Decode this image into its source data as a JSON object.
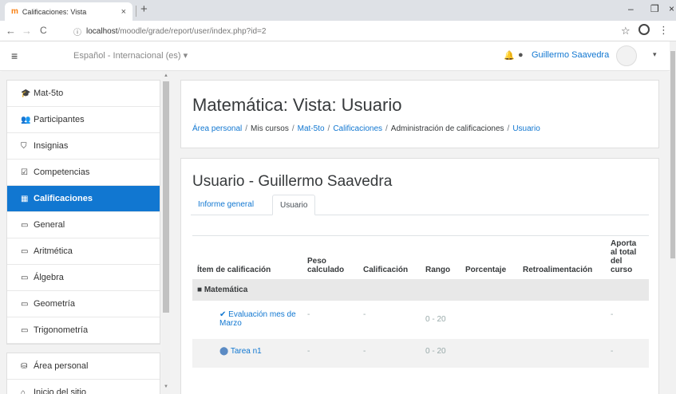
{
  "browser": {
    "tab_title": "Calificaciones: Vista",
    "tab_close": "×",
    "new_tab": "+",
    "win_min": "–",
    "win_max": "❐",
    "win_close": "×",
    "back": "←",
    "forward": "→",
    "reload": "C",
    "url_host": "localhost",
    "url_path": "/moodle/grade/report/user/index.php?id=2",
    "star": "☆",
    "menu": "⋮"
  },
  "navbar": {
    "menu_icon": "≡",
    "language": "Español - Internacional (es) ▾",
    "bell": "🔔",
    "chat": "●",
    "user_name": "Guillermo Saavedra",
    "user_caret": "▾"
  },
  "drawer": {
    "course_items": [
      {
        "icon": "🎓",
        "label": "Mat-5to"
      },
      {
        "icon": "👥",
        "label": "Participantes"
      },
      {
        "icon": "⛉",
        "label": "Insignias"
      },
      {
        "icon": "☑",
        "label": "Competencias"
      },
      {
        "icon": "▦",
        "label": "Calificaciones"
      },
      {
        "icon": "▭",
        "label": "General"
      },
      {
        "icon": "▭",
        "label": "Aritmética"
      },
      {
        "icon": "▭",
        "label": "Álgebra"
      },
      {
        "icon": "▭",
        "label": "Geometría"
      },
      {
        "icon": "▭",
        "label": "Trigonometría"
      }
    ],
    "site_items": [
      {
        "icon": "⛁",
        "label": "Área personal"
      },
      {
        "icon": "⌂",
        "label": "Inicio del sitio"
      }
    ]
  },
  "page": {
    "title": "Matemática: Vista: Usuario",
    "breadcrumb": [
      {
        "label": "Área personal",
        "link": true
      },
      {
        "label": "Mis cursos",
        "link": false
      },
      {
        "label": "Mat-5to",
        "link": true
      },
      {
        "label": "Calificaciones",
        "link": true
      },
      {
        "label": "Administración de calificaciones",
        "link": false
      },
      {
        "label": "Usuario",
        "link": true
      }
    ],
    "breadcrumb_sep": "/"
  },
  "report": {
    "title": "Usuario - Guillermo Saavedra",
    "tabs": [
      "Informe general",
      "Usuario"
    ],
    "columns": [
      "Ítem de calificación",
      "Peso calculado",
      "Calificación",
      "Rango",
      "Porcentaje",
      "Retroalimentación",
      "Aporta al total del curso"
    ],
    "category": {
      "icon": "■",
      "label": "Matemática"
    },
    "rows": [
      {
        "icon": "✔",
        "item": "Evaluación mes de Marzo",
        "weight": "-",
        "grade": "-",
        "range": "0 - 20",
        "percent": "",
        "feedback": "",
        "contrib": "-"
      },
      {
        "icon": "⬤",
        "item": "Tarea n1",
        "weight": "-",
        "grade": "-",
        "range": "0 - 20",
        "percent": "",
        "feedback": "",
        "contrib": "-"
      }
    ]
  }
}
